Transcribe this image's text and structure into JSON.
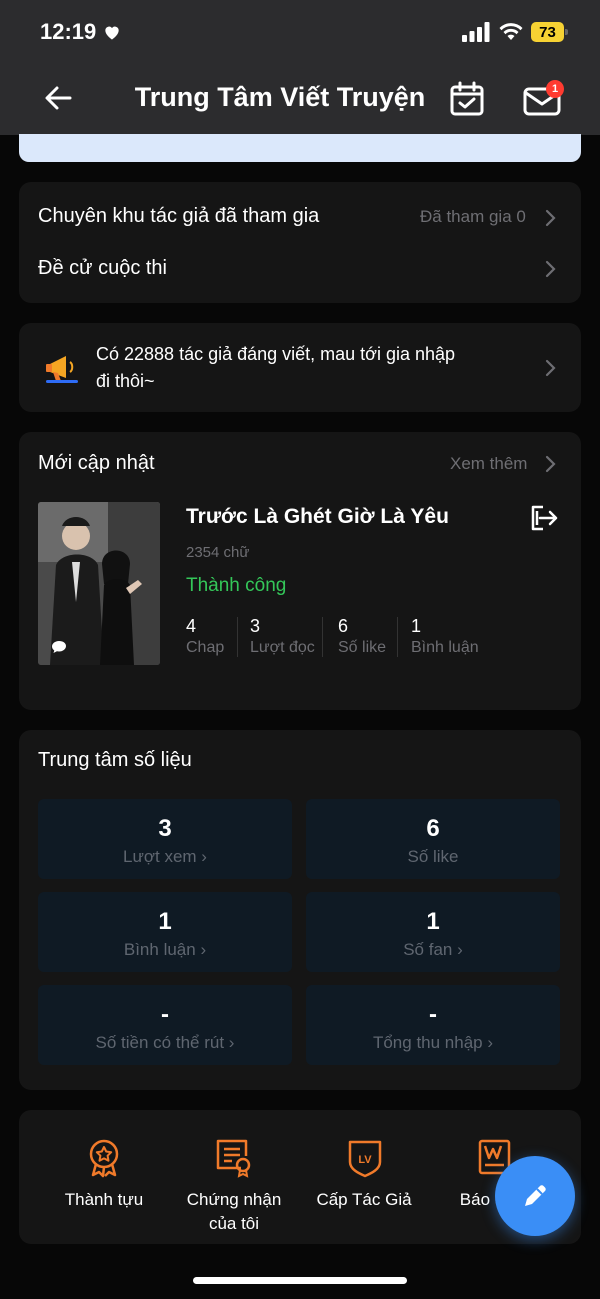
{
  "status_bar": {
    "time": "12:19",
    "battery": "73"
  },
  "header": {
    "title": "Trung Tâm Viết Truyện",
    "mail_badge": "1"
  },
  "zone_card": {
    "joined_label": "Chuyên khu tác giả đã tham gia",
    "joined_value": "Đã tham gia 0",
    "nominate_label": "Đề cử cuộc thi"
  },
  "promo": {
    "text_line1": "Có 22888 tác giả đáng viết, mau tới gia nhập",
    "text_line2": "đi thôi~"
  },
  "updates": {
    "heading": "Mới cập nhật",
    "see_more": "Xem thêm",
    "story": {
      "title": "Trước Là Ghét Giờ Là Yêu",
      "words": "2354 chữ",
      "status": "Thành công",
      "stats": [
        {
          "value": "4",
          "label": "Chap"
        },
        {
          "value": "3",
          "label": "Lượt đọc"
        },
        {
          "value": "6",
          "label": "Số like"
        },
        {
          "value": "1",
          "label": "Bình luận"
        }
      ]
    }
  },
  "data_center": {
    "heading": "Trung tâm số liệu",
    "tiles": [
      {
        "value": "3",
        "label": "Lượt xem"
      },
      {
        "value": "6",
        "label": "Số like"
      },
      {
        "value": "1",
        "label": "Bình luận"
      },
      {
        "value": "1",
        "label": "Số fan"
      },
      {
        "value": "-",
        "label": "Số tiền có thể rút"
      },
      {
        "value": "-",
        "label": "Tổng thu nhập"
      }
    ]
  },
  "tools": [
    {
      "label": "Thành tựu",
      "icon": "medal-icon"
    },
    {
      "label_line1": "Chứng nhận",
      "label_line2": "của tôi",
      "icon": "certificate-icon"
    },
    {
      "label": "Cấp Tác Giả",
      "icon": "level-badge-icon"
    },
    {
      "label": "Báo cáo",
      "icon": "report-icon"
    }
  ],
  "colors": {
    "accent": "#3a8ef6",
    "success": "#34c759",
    "tool_orange": "#f07a2a"
  }
}
